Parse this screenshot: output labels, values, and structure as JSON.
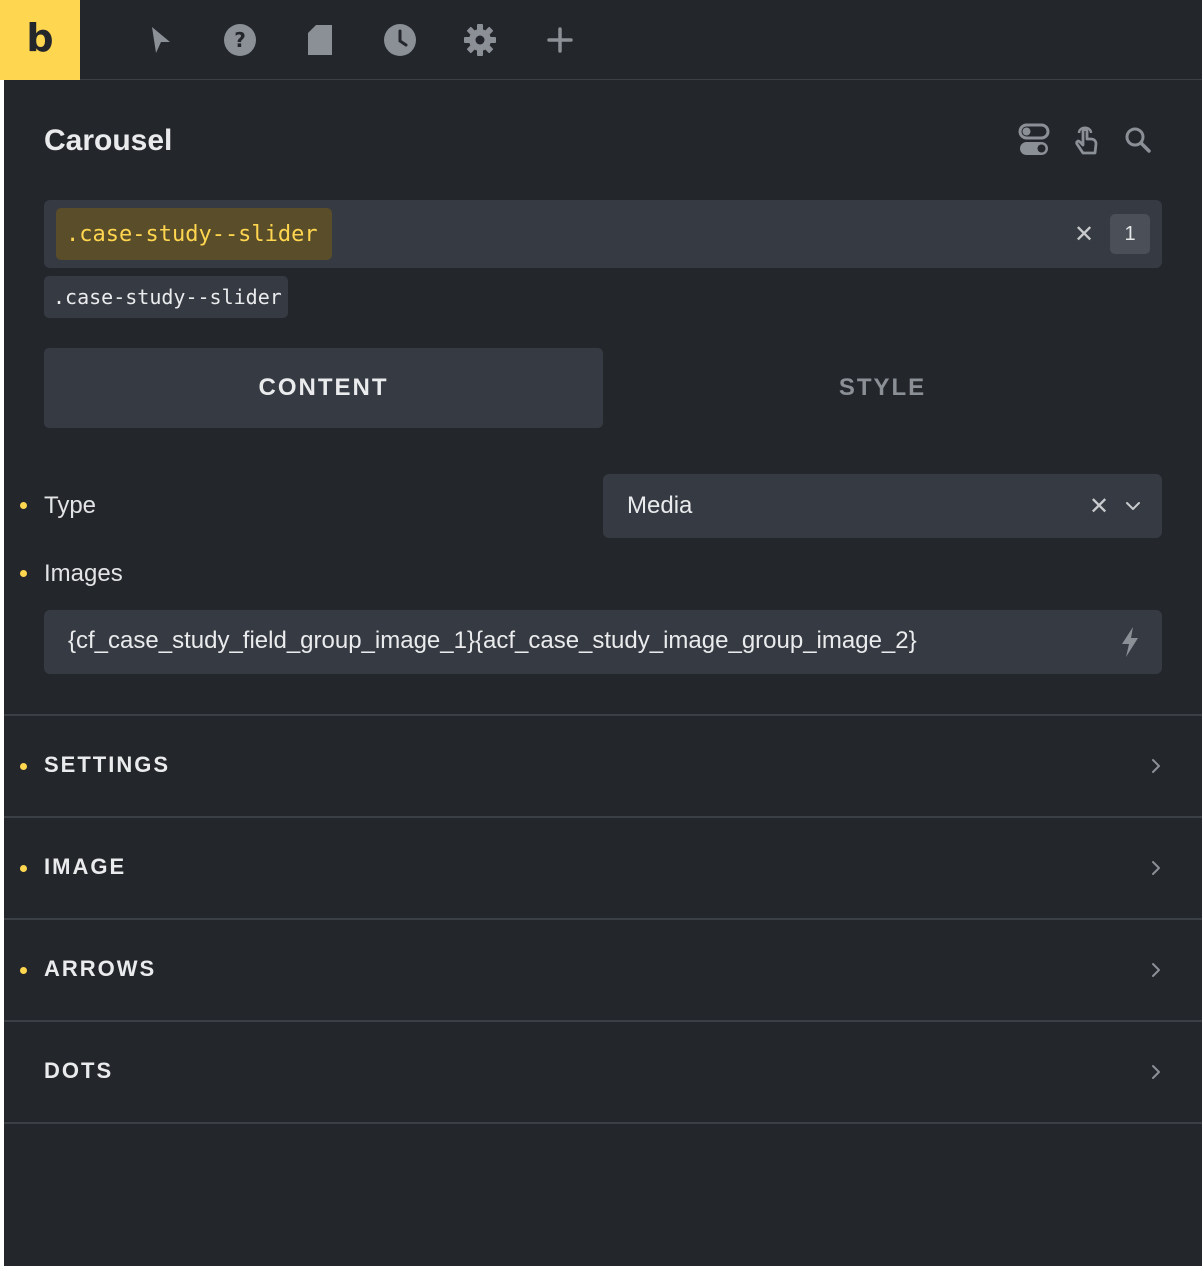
{
  "app": {
    "logo_letter": "b",
    "accent_color": "#ffd64f",
    "panel_color": "#23262b"
  },
  "toolbar": {
    "icons": [
      "cursor-icon",
      "help-icon",
      "page-icon",
      "history-icon",
      "gear-icon",
      "plus-icon"
    ]
  },
  "element": {
    "title": "Carousel",
    "header_icons": [
      "toggle-icon",
      "pointer-hand-icon",
      "search-icon"
    ]
  },
  "selector": {
    "active_class": ".case-study--slider",
    "clear_label": "✕",
    "count": "1",
    "secondary_class": ".case-study--slider"
  },
  "tabs": [
    {
      "label": "CONTENT",
      "active": true
    },
    {
      "label": "STYLE",
      "active": false
    }
  ],
  "fields": {
    "type": {
      "label": "Type",
      "value": "Media",
      "clear_label": "✕"
    },
    "images": {
      "label": "Images",
      "value": "{cf_case_study_field_group_image_1}{acf_case_study_image_group_image_2}"
    }
  },
  "sections": [
    {
      "title": "SETTINGS",
      "modified": true
    },
    {
      "title": "IMAGE",
      "modified": true
    },
    {
      "title": "ARROWS",
      "modified": true
    },
    {
      "title": "DOTS",
      "modified": false
    }
  ]
}
